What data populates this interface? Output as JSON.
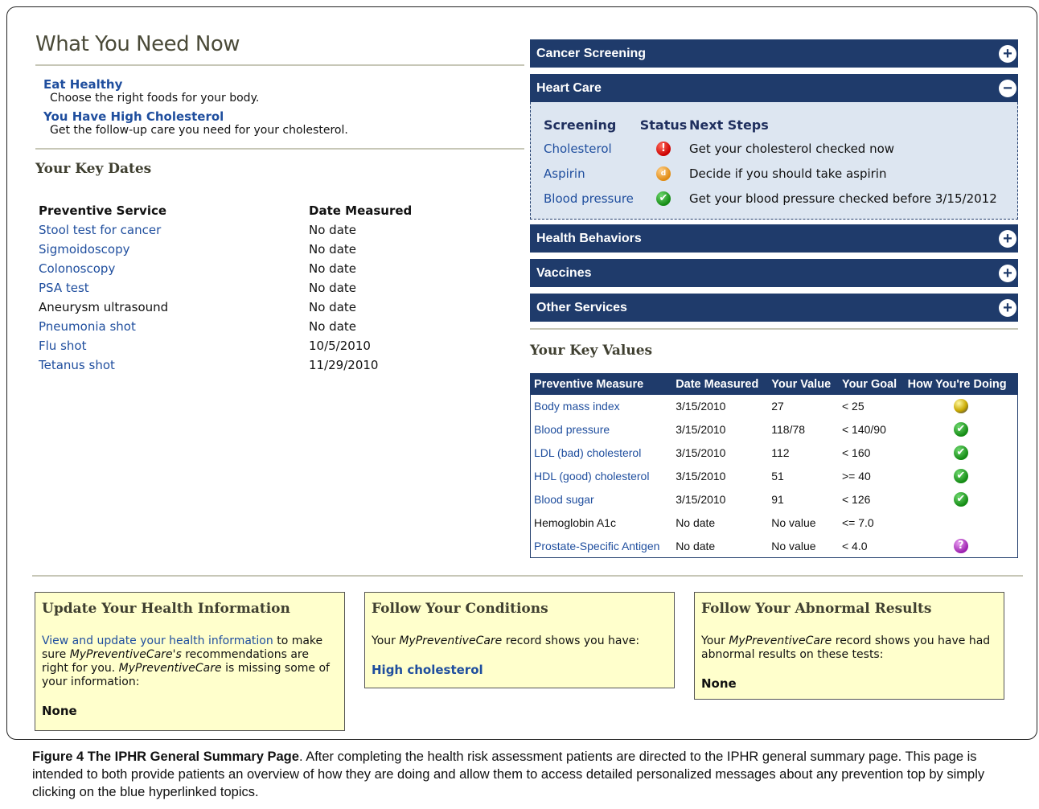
{
  "need_now": {
    "title": "What You Need Now",
    "items": [
      {
        "title": "Eat Healthy",
        "desc": "Choose the right foods for your body."
      },
      {
        "title": "You Have High Cholesterol",
        "desc": "Get the follow-up care you need for your cholesterol."
      }
    ]
  },
  "key_dates": {
    "title": "Your Key Dates",
    "col_service": "Preventive Service",
    "col_date": "Date Measured",
    "rows": [
      {
        "service": "Stool test for cancer",
        "date": "No date"
      },
      {
        "service": "Sigmoidoscopy",
        "date": "No date"
      },
      {
        "service": "Colonoscopy",
        "date": "No date"
      },
      {
        "service": "PSA test",
        "date": "No date"
      },
      {
        "service": "Aneurysm ultrasound",
        "date": "No date"
      },
      {
        "service": "Pneumonia shot",
        "date": "No date"
      },
      {
        "service": "Flu shot",
        "date": "10/5/2010"
      },
      {
        "service": "Tetanus shot",
        "date": "11/29/2010"
      }
    ]
  },
  "accordion": {
    "cancer": "Cancer Screening",
    "heart": "Heart Care",
    "health_behaviors": "Health Behaviors",
    "vaccines": "Vaccines",
    "other": "Other Services",
    "plus": "+",
    "minus": "−"
  },
  "heart_care": {
    "col_screening": "Screening",
    "col_status": "Status",
    "col_next": "Next Steps",
    "rows": [
      {
        "screening": "Cholesterol",
        "status": "alert",
        "icon": "alert-icon",
        "glyph": "!",
        "next": "Get your cholesterol checked now"
      },
      {
        "screening": "Aspirin",
        "status": "decide",
        "icon": "decide-icon",
        "glyph": "d",
        "next": "Decide if you should take aspirin"
      },
      {
        "screening": "Blood pressure",
        "status": "ok",
        "icon": "check-icon",
        "glyph": "✔",
        "next": "Get your blood pressure checked before 3/15/2012"
      }
    ]
  },
  "key_values": {
    "title": "Your Key Values",
    "headers": [
      "Preventive Measure",
      "Date Measured",
      "Your Value",
      "Your Goal",
      "How You're Doing"
    ],
    "rows": [
      {
        "measure": "Body mass index",
        "date": "3/15/2010",
        "value": "27",
        "goal": "< 25",
        "doing": "warning",
        "glyph": ""
      },
      {
        "measure": "Blood pressure",
        "date": "3/15/2010",
        "value": "118/78",
        "goal": "< 140/90",
        "doing": "ok",
        "glyph": "✔"
      },
      {
        "measure": "LDL (bad) cholesterol",
        "date": "3/15/2010",
        "value": "112",
        "goal": "< 160",
        "doing": "ok",
        "glyph": "✔"
      },
      {
        "measure": "HDL (good) cholesterol",
        "date": "3/15/2010",
        "value": "51",
        "goal": ">= 40",
        "doing": "ok",
        "glyph": "✔"
      },
      {
        "measure": "Blood sugar",
        "date": "3/15/2010",
        "value": "91",
        "goal": "< 126",
        "doing": "ok",
        "glyph": "✔"
      },
      {
        "measure": "Hemoglobin A1c",
        "date": "No date",
        "value": "No value",
        "goal": "<= 7.0",
        "doing": "none",
        "glyph": ""
      },
      {
        "measure": "Prostate-Specific Antigen",
        "date": "No date",
        "value": "No value",
        "goal": "< 4.0",
        "doing": "unknown",
        "glyph": "?"
      }
    ]
  },
  "boxes": {
    "update": {
      "title": "Update Your Health Information",
      "link": "View and update your health information",
      "text1": " to make sure ",
      "brand1": "MyPreventiveCare's",
      "text2": " recommendations are right for you. ",
      "brand2": "MyPreventiveCare",
      "text3": " is missing some of your information:",
      "value": "None"
    },
    "conditions": {
      "title": "Follow Your Conditions",
      "text1": "Your ",
      "brand": "MyPreventiveCare",
      "text2": " record shows you have:",
      "value": "High cholesterol"
    },
    "abnormal": {
      "title": "Follow Your Abnormal Results",
      "text1": "Your ",
      "brand": "MyPreventiveCare",
      "text2": " record shows you have had abnormal results on these tests:",
      "value": "None"
    }
  },
  "caption": {
    "label": "Figure 4 The IPHR General Summary Page",
    "text": ". After completing the health risk assessment patients are directed to the IPHR general summary page. This page is intended to both provide patients an overview of how they are doing and allow them to access detailed personalized messages about any prevention top by simply clicking on the blue hyperlinked topics."
  },
  "colors": {
    "accent": "#1f3b6b",
    "link": "#1f4e9e",
    "panel": "#dde6f1",
    "box": "#ffffcc"
  }
}
